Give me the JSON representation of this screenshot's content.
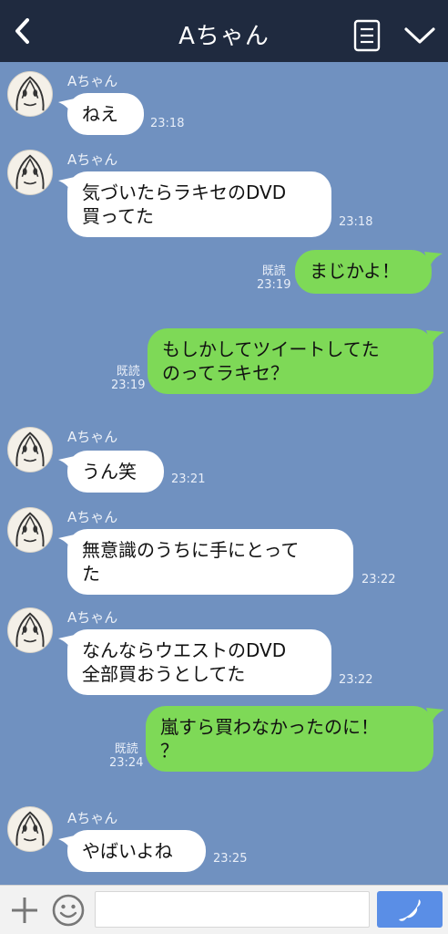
{
  "header": {
    "title": "Aちゃん"
  },
  "messages": [
    {
      "type": "in",
      "sender": "Aちゃん",
      "lines": [
        "ねえ"
      ],
      "time": "23:18"
    },
    {
      "type": "in",
      "sender": "Aちゃん",
      "lines": [
        "気づいたらラキセのDVD",
        "買ってた"
      ],
      "time": "23:18"
    },
    {
      "type": "out",
      "lines": [
        "まじかよ！"
      ],
      "read": "既読",
      "time": "23:19"
    },
    {
      "type": "out",
      "lines": [
        "もしかしてツイートしてた",
        "のってラキセ？"
      ],
      "read": "既読",
      "time": "23:19"
    },
    {
      "type": "in",
      "sender": "Aちゃん",
      "lines": [
        "うん笑"
      ],
      "time": "23:21"
    },
    {
      "type": "in",
      "sender": "Aちゃん",
      "lines": [
        "無意識のうちに手にとって",
        "た"
      ],
      "time": "23:22"
    },
    {
      "type": "in",
      "sender": "Aちゃん",
      "lines": [
        "なんならウエストのDVD",
        "全部買おうとしてた"
      ],
      "time": "23:22"
    },
    {
      "type": "out",
      "lines": [
        "嵐すら買わなかったのに！",
        "？"
      ],
      "read": "既読",
      "time": "23:24"
    },
    {
      "type": "in",
      "sender": "Aちゃん",
      "lines": [
        "やばいよね"
      ],
      "time": "23:25"
    }
  ],
  "input": {
    "placeholder": ""
  },
  "icons": {
    "back": "back-chevron-icon",
    "notes": "notes-icon",
    "dropdown": "chevron-down-icon",
    "plus": "plus-icon",
    "emoji": "emoji-icon",
    "call": "phone-icon"
  },
  "colors": {
    "header_bg": "#1f2a3f",
    "chat_bg": "#7091c0",
    "incoming_bubble": "#ffffff",
    "outgoing_bubble": "#7ed957",
    "call_button": "#5a8ee6"
  }
}
